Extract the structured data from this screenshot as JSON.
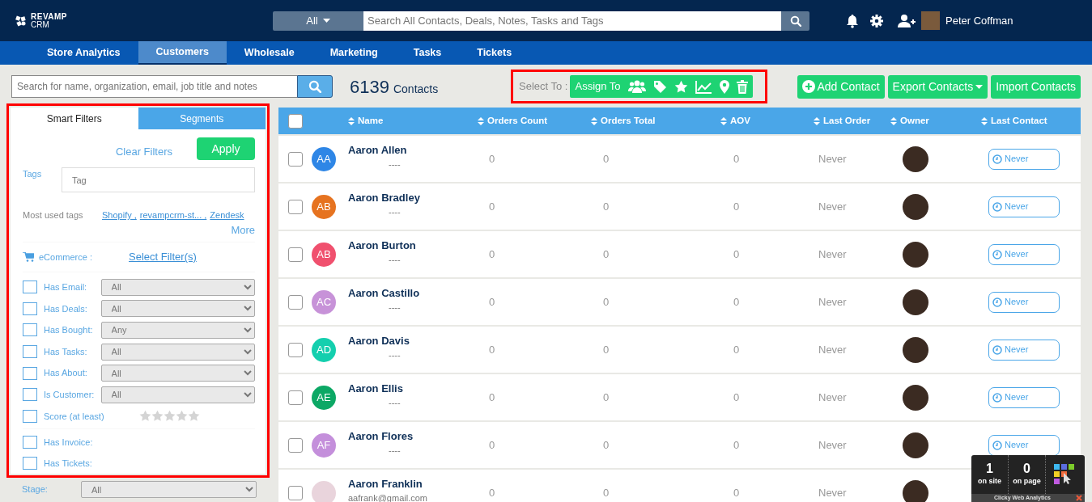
{
  "brand": {
    "line1": "REVAMP",
    "line2": "CRM"
  },
  "global_search": {
    "scope": "All",
    "placeholder": "Search All Contacts, Deals, Notes, Tasks and Tags"
  },
  "user": {
    "name": "Peter Coffman"
  },
  "nav_tabs": [
    {
      "label": "Store Analytics",
      "selected": false
    },
    {
      "label": "Customers",
      "selected": true
    },
    {
      "label": "Wholesale",
      "selected": false
    },
    {
      "label": "Marketing",
      "selected": false
    },
    {
      "label": "Tasks",
      "selected": false
    },
    {
      "label": "Tickets",
      "selected": false
    }
  ],
  "contact_search": {
    "placeholder": "Search for name, organization, email, job title and notes"
  },
  "contact_count": {
    "number": "6139",
    "label": "Contacts"
  },
  "bulk_actions": {
    "label": "Select To :",
    "assign_label": "Assign To"
  },
  "action_buttons": [
    {
      "label": "Add Contact",
      "kind": "add"
    },
    {
      "label": "Export Contacts",
      "kind": "dropdown"
    },
    {
      "label": "Import Contacts",
      "kind": "plain"
    }
  ],
  "filter_tabs": [
    {
      "label": "Smart Filters",
      "selected": true
    },
    {
      "label": "Segments",
      "selected": false
    }
  ],
  "filters": {
    "clear_label": "Clear Filters",
    "apply_label": "Apply",
    "tags_label": "Tags",
    "tag_placeholder": "Tag",
    "most_used_label": "Most used tags",
    "most_used_tags": [
      "Shopify ,",
      "revampcrm-st... ,",
      "Zendesk"
    ],
    "more_label": "More",
    "ecommerce_label": "eCommerce :",
    "ecommerce_link": "Select Filter(s)",
    "rows": [
      {
        "kind": "select",
        "label": "Has Email:",
        "checked": false,
        "value": "All"
      },
      {
        "kind": "select",
        "label": "Has Deals:",
        "checked": false,
        "value": "All"
      },
      {
        "kind": "select",
        "label": "Has Bought:",
        "checked": false,
        "value": "Any"
      },
      {
        "kind": "select",
        "label": "Has Tasks:",
        "checked": false,
        "value": "All"
      },
      {
        "kind": "select",
        "label": "Has About:",
        "checked": false,
        "value": "All"
      },
      {
        "kind": "select",
        "label": "Is Customer:",
        "checked": false,
        "value": "All"
      },
      {
        "kind": "stars",
        "label": "Score (at least)",
        "checked": false,
        "stars": 0
      },
      {
        "kind": "divider"
      },
      {
        "kind": "plain",
        "label": "Has Invoice:",
        "checked": false
      },
      {
        "kind": "plain",
        "label": "Has Tickets:",
        "checked": false
      }
    ]
  },
  "stage": {
    "label": "Stage:",
    "value": "All"
  },
  "table": {
    "select_all_checked": false,
    "columns": [
      "Name",
      "Orders Count",
      "Orders Total",
      "AOV",
      "Last Order",
      "Owner",
      "Last Contact"
    ],
    "rows": [
      {
        "kind": "initials",
        "initials": "AA",
        "color": "#2e86e6",
        "name": "Aaron Allen",
        "subtitle": "----",
        "orders_count": "0",
        "orders_total": "0",
        "aov": "0",
        "last_order": "Never",
        "last_contact": "Never",
        "checked": false
      },
      {
        "kind": "initials",
        "initials": "AB",
        "color": "#e67320",
        "name": "Aaron Bradley",
        "subtitle": "----",
        "orders_count": "0",
        "orders_total": "0",
        "aov": "0",
        "last_order": "Never",
        "last_contact": "Never",
        "checked": false
      },
      {
        "kind": "initials",
        "initials": "AB",
        "color": "#f0506e",
        "name": "Aaron Burton",
        "subtitle": "----",
        "orders_count": "0",
        "orders_total": "0",
        "aov": "0",
        "last_order": "Never",
        "last_contact": "Never",
        "checked": false
      },
      {
        "kind": "initials",
        "initials": "AC",
        "color": "#c792d8",
        "name": "Aaron Castillo",
        "subtitle": "----",
        "orders_count": "0",
        "orders_total": "0",
        "aov": "0",
        "last_order": "Never",
        "last_contact": "Never",
        "checked": false
      },
      {
        "kind": "initials",
        "initials": "AD",
        "color": "#14cfae",
        "name": "Aaron Davis",
        "subtitle": "----",
        "orders_count": "0",
        "orders_total": "0",
        "aov": "0",
        "last_order": "Never",
        "last_contact": "Never",
        "checked": false
      },
      {
        "kind": "initials",
        "initials": "AE",
        "color": "#0ca865",
        "name": "Aaron Ellis",
        "subtitle": "----",
        "orders_count": "0",
        "orders_total": "0",
        "aov": "0",
        "last_order": "Never",
        "last_contact": "Never",
        "checked": false
      },
      {
        "kind": "initials",
        "initials": "AF",
        "color": "#c48fdb",
        "name": "Aaron Flores",
        "subtitle": "----",
        "orders_count": "0",
        "orders_total": "0",
        "aov": "0",
        "last_order": "Never",
        "last_contact": "Never",
        "checked": false
      },
      {
        "kind": "photo",
        "name": "Aaron Franklin",
        "subtitle": "aafrank@gmail.com",
        "orders_count": "0",
        "orders_total": "0",
        "aov": "0",
        "last_order": "Never",
        "checked": false
      }
    ]
  },
  "analytics_widget": {
    "on_site_count": "1",
    "on_site_label": "on site",
    "on_page_count": "0",
    "on_page_label": "on page",
    "footer": "Clicky Web Analytics"
  }
}
